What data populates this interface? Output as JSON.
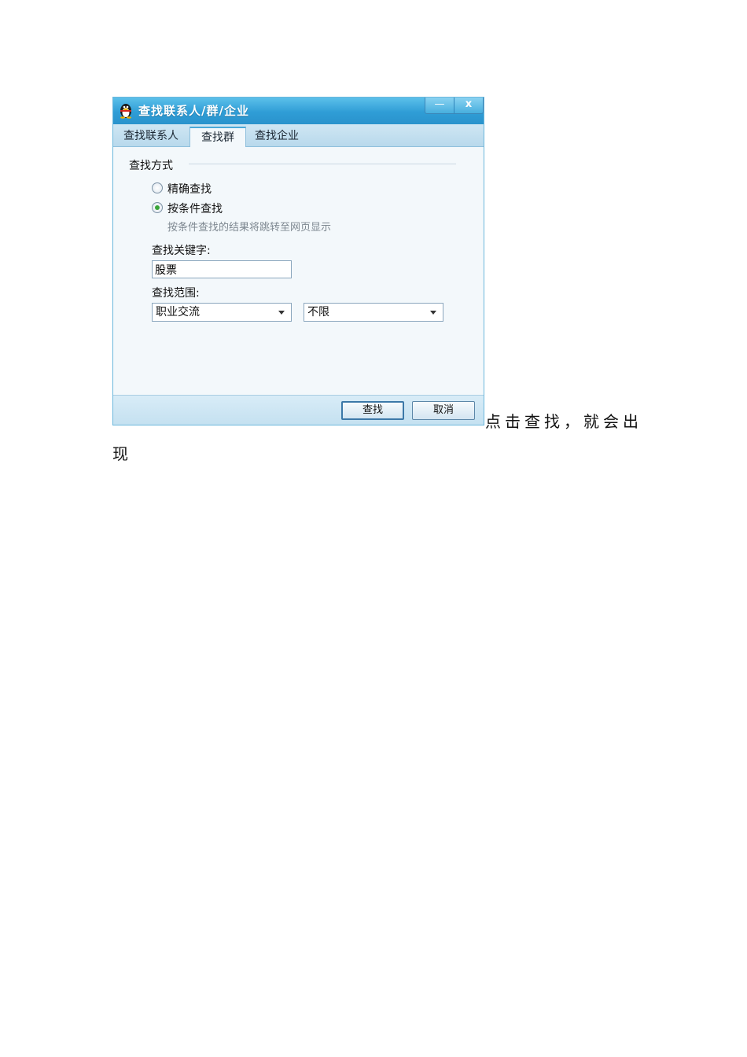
{
  "dialog": {
    "title": "查找联系人/群/企业",
    "minimize_glyph": "—",
    "close_glyph": "x",
    "tabs": [
      {
        "label": "查找联系人",
        "active": false
      },
      {
        "label": "查找群",
        "active": true
      },
      {
        "label": "查找企业",
        "active": false
      }
    ],
    "search_mode": {
      "label": "查找方式",
      "options": [
        {
          "label": "精确查找",
          "checked": false
        },
        {
          "label": "按条件查找",
          "checked": true
        }
      ],
      "hint": "按条件查找的结果将跳转至网页显示"
    },
    "keyword": {
      "label": "查找关键字:",
      "value": "股票"
    },
    "range": {
      "label": "查找范围:",
      "select1": "职业交流",
      "select2": "不限"
    },
    "buttons": {
      "find": "查找",
      "cancel": "取消"
    },
    "colors": {
      "titlebar": "#2f9dd6",
      "radio_checked": "#3aa53a"
    }
  },
  "body_text": {
    "line1": "点击查找，就会出",
    "line2": "现"
  }
}
